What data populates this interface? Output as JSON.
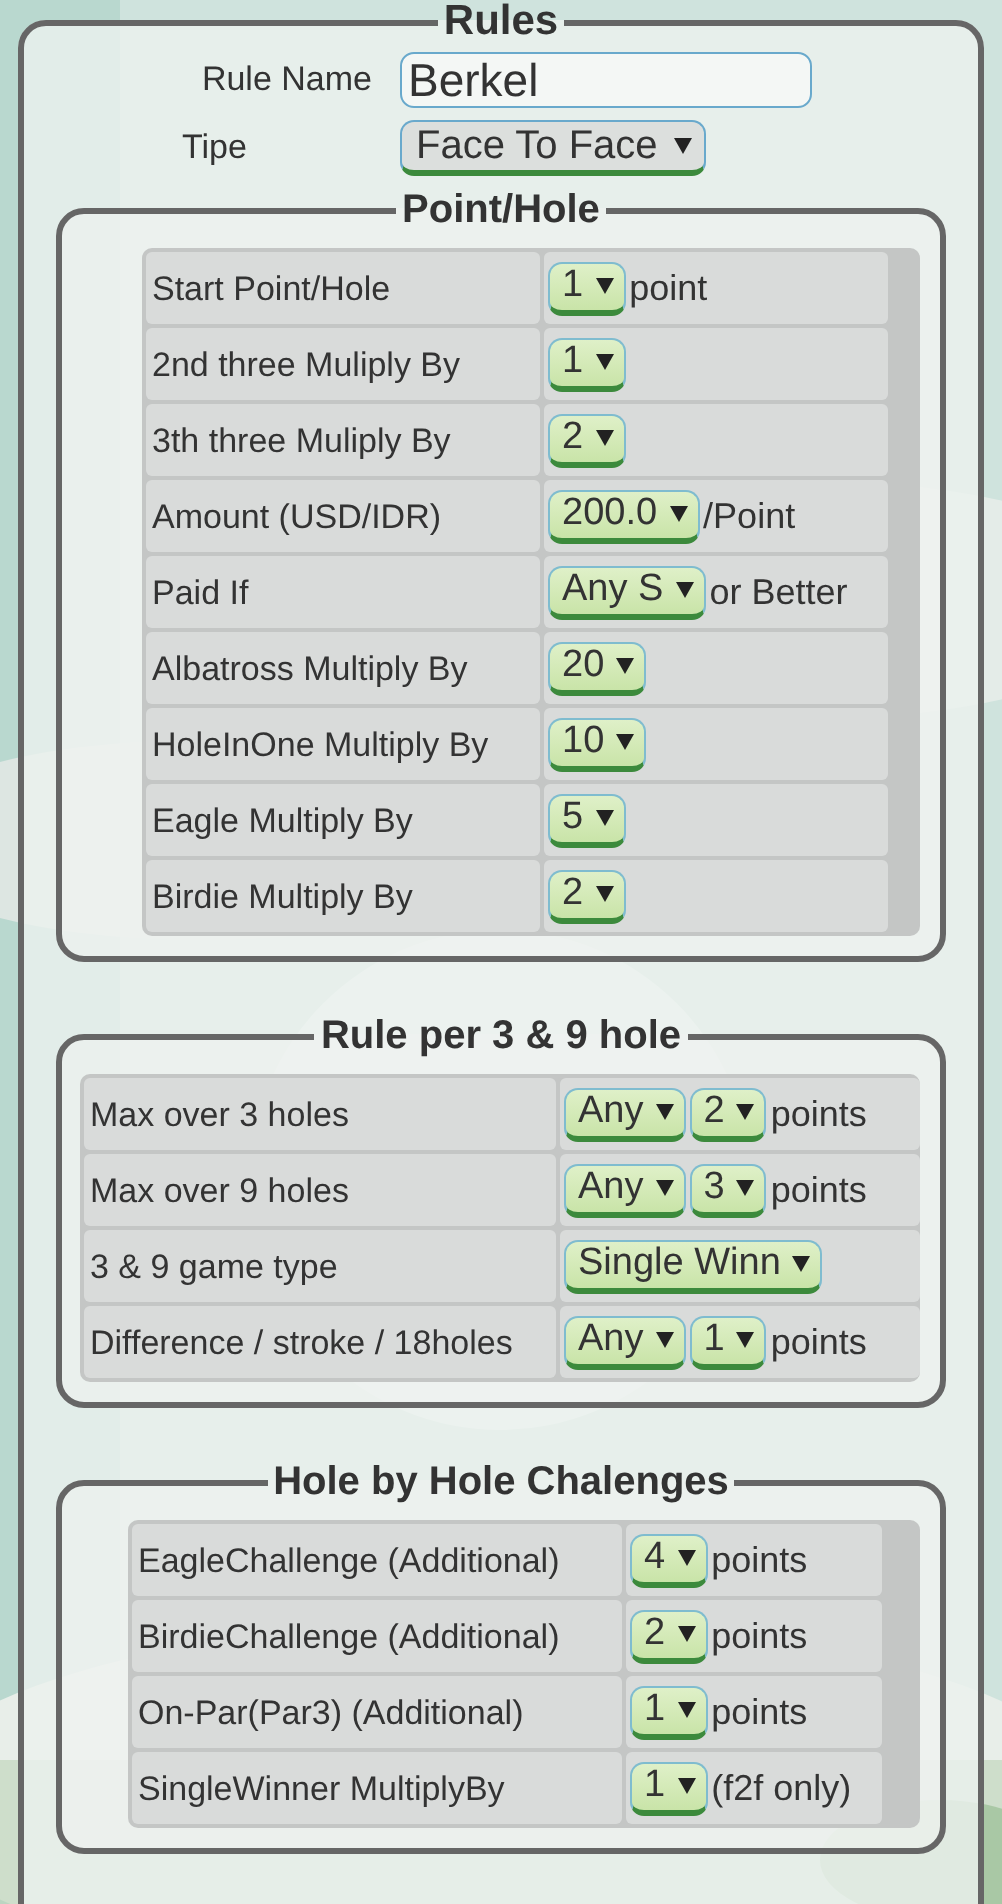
{
  "rules": {
    "title": "Rules",
    "fields": [
      {
        "kind": "text",
        "label": "Rule Name",
        "value": "Berkel"
      },
      {
        "kind": "select",
        "label": "Tipe",
        "value": "Face To Face"
      }
    ]
  },
  "sections": [
    {
      "title": "Point/Hole",
      "rows": [
        {
          "label": "Start Point/Hole",
          "items": [
            {
              "kind": "select",
              "value": "1"
            },
            {
              "kind": "unit",
              "text": "point"
            }
          ]
        },
        {
          "label": "2nd three Muliply By",
          "items": [
            {
              "kind": "select",
              "value": "1"
            }
          ]
        },
        {
          "label": "3th three Muliply By",
          "items": [
            {
              "kind": "select",
              "value": "2"
            }
          ]
        },
        {
          "label": "Amount (USD/IDR)",
          "items": [
            {
              "kind": "select",
              "value": "200.0"
            },
            {
              "kind": "unit",
              "text": "/Point"
            }
          ]
        },
        {
          "label": "Paid If",
          "items": [
            {
              "kind": "select",
              "value": "Any S"
            },
            {
              "kind": "unit",
              "text": "or Better"
            }
          ]
        },
        {
          "label": "Albatross Multiply By",
          "items": [
            {
              "kind": "select",
              "value": "20"
            }
          ]
        },
        {
          "label": "HoleInOne Multiply By",
          "items": [
            {
              "kind": "select",
              "value": "10"
            }
          ]
        },
        {
          "label": "Eagle Multiply By",
          "items": [
            {
              "kind": "select",
              "value": "5"
            }
          ]
        },
        {
          "label": "Birdie Multiply By",
          "items": [
            {
              "kind": "select",
              "value": "2"
            }
          ]
        }
      ]
    },
    {
      "title": "Rule per 3 & 9 hole",
      "rows": [
        {
          "label": "Max over 3 holes",
          "items": [
            {
              "kind": "select",
              "value": "Any"
            },
            {
              "kind": "select",
              "value": "2"
            },
            {
              "kind": "unit",
              "text": "points"
            }
          ]
        },
        {
          "label": "Max over 9 holes",
          "items": [
            {
              "kind": "select",
              "value": "Any"
            },
            {
              "kind": "select",
              "value": "3"
            },
            {
              "kind": "unit",
              "text": "points"
            }
          ]
        },
        {
          "label": "3 & 9 game type",
          "items": [
            {
              "kind": "select",
              "value": "Single Winn"
            }
          ]
        },
        {
          "label": "Difference / stroke / 18holes",
          "items": [
            {
              "kind": "select",
              "value": "Any"
            },
            {
              "kind": "select",
              "value": "1"
            },
            {
              "kind": "unit",
              "text": "points"
            }
          ]
        }
      ]
    },
    {
      "title": "Hole by Hole Chalenges",
      "rows": [
        {
          "label": "EagleChallenge (Additional)",
          "items": [
            {
              "kind": "select",
              "value": "4"
            },
            {
              "kind": "unit",
              "text": "points"
            }
          ]
        },
        {
          "label": "BirdieChallenge (Additional)",
          "items": [
            {
              "kind": "select",
              "value": "2"
            },
            {
              "kind": "unit",
              "text": "points"
            }
          ]
        },
        {
          "label": "On-Par(Par3) (Additional)",
          "items": [
            {
              "kind": "select",
              "value": "1"
            },
            {
              "kind": "unit",
              "text": "points"
            }
          ]
        },
        {
          "label": "SingleWinner MultiplyBy",
          "items": [
            {
              "kind": "select",
              "value": "1"
            },
            {
              "kind": "unit",
              "text": "(f2f only)"
            }
          ]
        }
      ]
    }
  ]
}
